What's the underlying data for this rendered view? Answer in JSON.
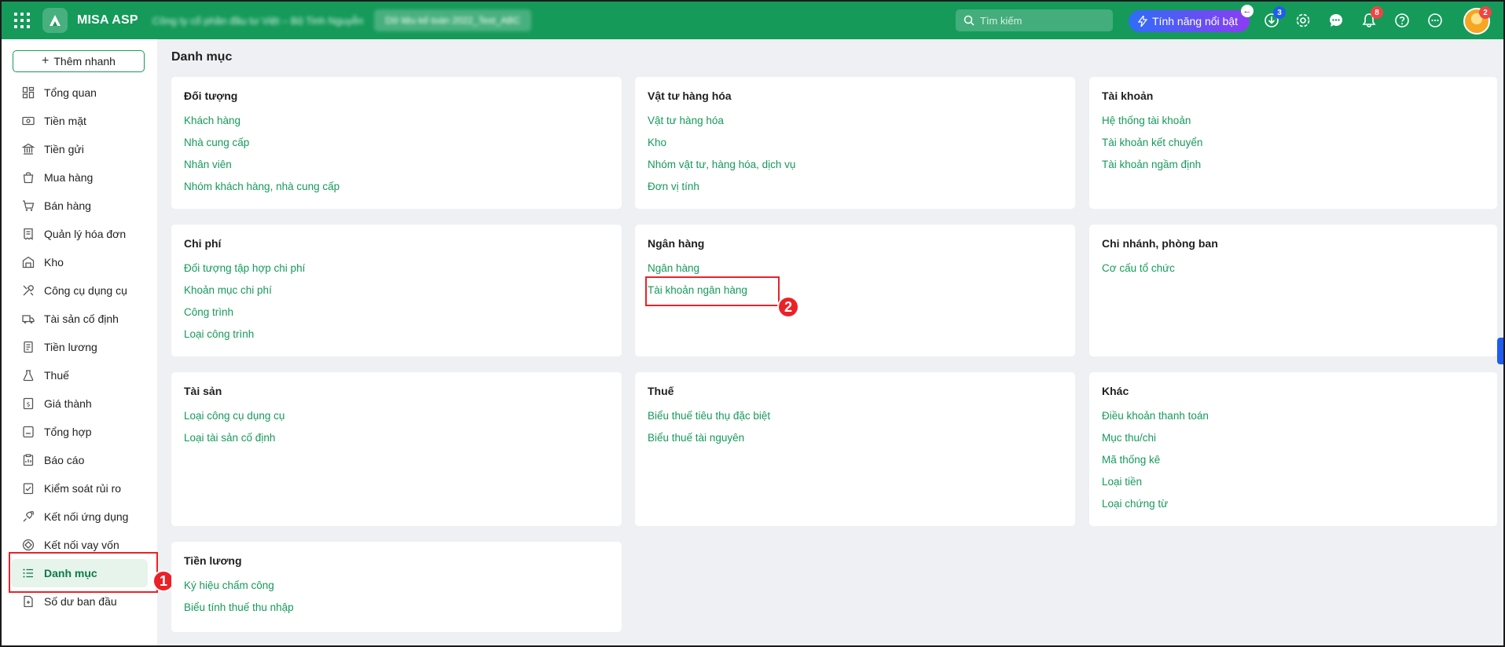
{
  "header": {
    "app_name": "MISA ASP",
    "company_name": "Công ty cổ phần đầu tư Việt – Bộ Tinh Nguyễn",
    "database_label": "Dữ liệu kế toán 2022_Test_ABC",
    "search_placeholder": "Tìm kiếm",
    "feature_button": "Tính năng nổi bật",
    "download_badge": "3",
    "notification_badge": "8",
    "avatar_badge": "2"
  },
  "sidebar": {
    "quick_add": "Thêm nhanh",
    "items": [
      {
        "label": "Tổng quan",
        "icon": "dashboard-icon"
      },
      {
        "label": "Tiền mặt",
        "icon": "cash-icon"
      },
      {
        "label": "Tiền gửi",
        "icon": "bank-icon"
      },
      {
        "label": "Mua hàng",
        "icon": "shopping-bag-icon"
      },
      {
        "label": "Bán hàng",
        "icon": "cart-icon"
      },
      {
        "label": "Quản lý hóa đơn",
        "icon": "invoice-icon"
      },
      {
        "label": "Kho",
        "icon": "warehouse-icon"
      },
      {
        "label": "Công cụ dụng cụ",
        "icon": "tools-icon"
      },
      {
        "label": "Tài sản cố định",
        "icon": "truck-icon"
      },
      {
        "label": "Tiền lương",
        "icon": "payroll-icon"
      },
      {
        "label": "Thuế",
        "icon": "tax-icon"
      },
      {
        "label": "Giá thành",
        "icon": "price-icon"
      },
      {
        "label": "Tổng hợp",
        "icon": "summary-icon"
      },
      {
        "label": "Báo cáo",
        "icon": "report-icon"
      },
      {
        "label": "Kiểm soát rủi ro",
        "icon": "risk-icon"
      },
      {
        "label": "Kết nối ứng dụng",
        "icon": "plug-icon"
      },
      {
        "label": "Kết nối vay vốn",
        "icon": "loan-icon"
      },
      {
        "label": "Danh mục",
        "icon": "list-icon",
        "active": true
      },
      {
        "label": "Số dư ban đầu",
        "icon": "balance-icon"
      }
    ]
  },
  "annotations": {
    "step1": "1",
    "step2": "2"
  },
  "main": {
    "title": "Danh mục",
    "cards": [
      {
        "title": "Đối tượng",
        "links": [
          "Khách hàng",
          "Nhà cung cấp",
          "Nhân viên",
          "Nhóm khách hàng, nhà cung cấp"
        ]
      },
      {
        "title": "Vật tư hàng hóa",
        "links": [
          "Vật tư hàng hóa",
          "Kho",
          "Nhóm vật tư, hàng hóa, dịch vụ",
          "Đơn vị tính"
        ]
      },
      {
        "title": "Tài khoản",
        "links": [
          "Hệ thống tài khoản",
          "Tài khoản kết chuyển",
          "Tài khoản ngầm định"
        ]
      },
      {
        "title": "Chi phí",
        "links": [
          "Đối tượng tập hợp chi phí",
          "Khoản mục chi phí",
          "Công trình",
          "Loại công trình"
        ]
      },
      {
        "title": "Ngân hàng",
        "links": [
          "Ngân hàng",
          "Tài khoản ngân hàng"
        ]
      },
      {
        "title": "Chi nhánh, phòng ban",
        "links": [
          "Cơ cấu tổ chức"
        ]
      },
      {
        "title": "Tài sản",
        "links": [
          "Loại công cụ dụng cụ",
          "Loại tài sản cố định"
        ]
      },
      {
        "title": "Thuế",
        "links": [
          "Biểu thuế tiêu thụ đặc biệt",
          "Biểu thuế tài nguyên"
        ]
      },
      {
        "title": "Khác",
        "links": [
          "Điều khoản thanh toán",
          "Mục thu/chi",
          "Mã thống kê",
          "Loại tiền",
          "Loại chứng từ"
        ]
      },
      {
        "title": "Tiền lương",
        "links": [
          "Ký hiệu chấm công",
          "Biểu tính thuế thu nhập"
        ]
      }
    ]
  }
}
